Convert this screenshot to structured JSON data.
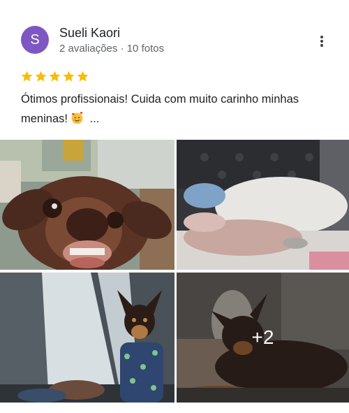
{
  "review": {
    "avatar_letter": "S",
    "author": "Sueli Kaori",
    "meta": "2 avaliações · 10 fotos",
    "rating": 5,
    "text_before_emoji": "Ótimos profissionais! Cuida com muito carinho minhas meninas!",
    "text_after_emoji": " ...",
    "emoji_icon": "smiling-face-with-hearts-icon"
  },
  "photos": {
    "count": 4,
    "more_count_label": "+2"
  },
  "colors": {
    "avatar": "#7e57c2",
    "star": "#fbbc04",
    "secondary_text": "#5f6368"
  }
}
